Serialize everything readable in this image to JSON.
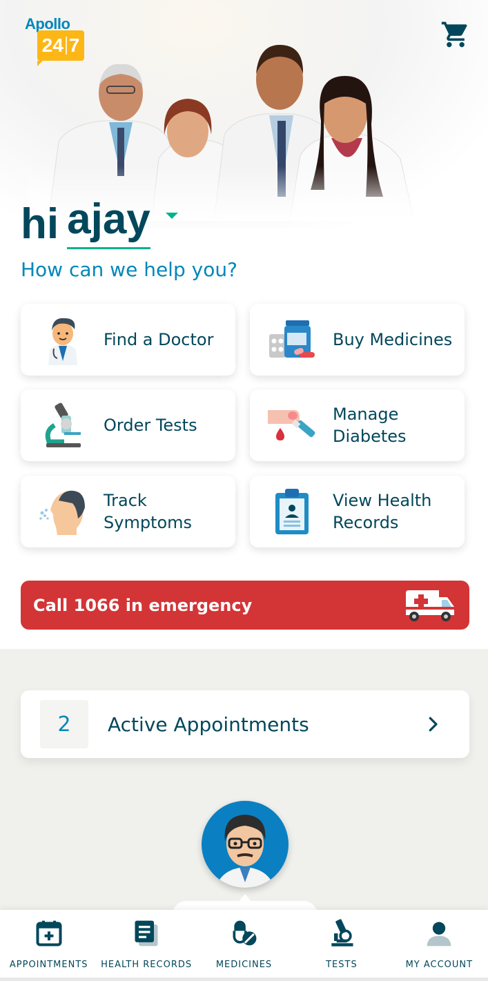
{
  "header": {
    "logo_text": "Apollo",
    "logo_badge": "24|7",
    "cart_icon": "cart-icon"
  },
  "greeting": {
    "hi": "hi",
    "name": "ajay"
  },
  "help_heading": "How can we help you?",
  "services": [
    {
      "label": "Find a Doctor",
      "icon": "doctor-icon"
    },
    {
      "label": "Buy Medicines",
      "icon": "medicines-icon"
    },
    {
      "label": "Order Tests",
      "icon": "microscope-icon"
    },
    {
      "label": "Manage Diabetes",
      "icon": "blood-drop-icon"
    },
    {
      "label": "Track Symptoms",
      "icon": "symptoms-icon"
    },
    {
      "label": "View Health Records",
      "icon": "clipboard-icon"
    }
  ],
  "emergency": {
    "label": "Call 1066 in emergency",
    "icon": "ambulance-icon",
    "color": "#d33436"
  },
  "appointments": {
    "count": "2",
    "label": "Active Appointments"
  },
  "tabs": [
    {
      "label": "APPOINTMENTS",
      "icon": "calendar-plus-icon"
    },
    {
      "label": "HEALTH RECORDS",
      "icon": "records-icon"
    },
    {
      "label": "MEDICINES",
      "icon": "pill-icon"
    },
    {
      "label": "TESTS",
      "icon": "microscope-icon"
    },
    {
      "label": "MY ACCOUNT",
      "icon": "person-icon"
    }
  ],
  "colors": {
    "primary": "#02475b",
    "accent": "#0087ba",
    "green": "#00b38e",
    "badge": "#fcb716"
  }
}
